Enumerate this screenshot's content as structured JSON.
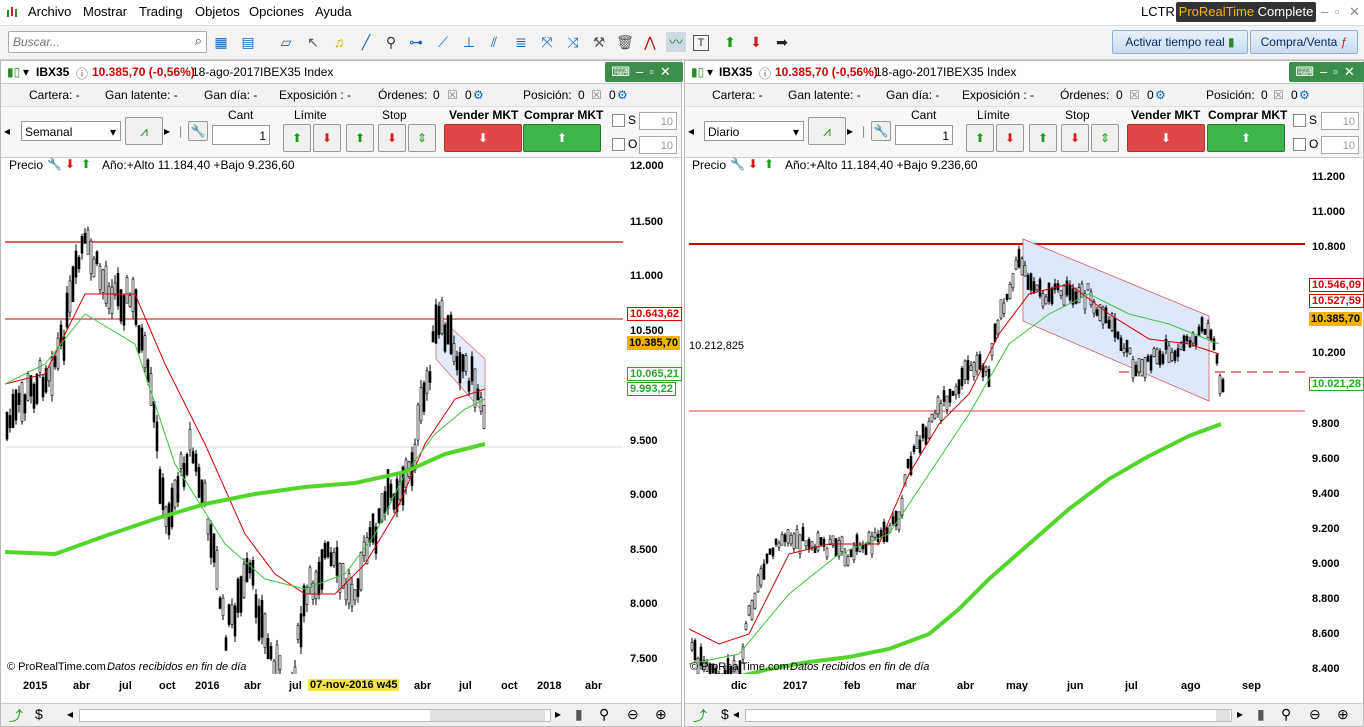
{
  "menu": [
    "Archivo",
    "Mostrar",
    "Trading",
    "Objetos",
    "Opciones",
    "Ayuda"
  ],
  "header": {
    "account": "LCTR",
    "brand_pre": "ProRealTime",
    "brand_post": "Complete"
  },
  "toolbar": {
    "search_placeholder": "Buscar...",
    "activate_label": "Activar tiempo real",
    "trade_label": "Compra/Venta"
  },
  "left": {
    "symbol": "IBX35",
    "price": "10.385,70 (-0,56%)",
    "date": "18-ago-2017",
    "index": "IBEX35 Index",
    "cartera": "Cartera: -",
    "gan_latente": "Gan latente: -",
    "gan_dia": "Gan día: -",
    "exposicion": "Exposición : -",
    "ordenes_label": "Órdenes:",
    "ordenes_val": "0",
    "ordenes_val2": "0",
    "posicion_label": "Posición:",
    "posicion_val": "0",
    "posicion_val2": "0",
    "period": "Semanal",
    "cant_label": "Cant",
    "cant": "1",
    "limite": "Límite",
    "stop": "Stop",
    "sell": "Vender MKT",
    "buy": "Comprar MKT",
    "s_label": "S",
    "o_label": "O",
    "s_val": "10",
    "o_val": "10",
    "legend_price": "Precio",
    "legend_info": "Año:+Alto 11.184,40 +Bajo 9.236,60",
    "footer_copy": "© ProRealTime.com",
    "footer_note": "Datos recibidos en fin de día",
    "yticks": [
      "12.000",
      "11.500",
      "11.000",
      "10.500",
      "9.500",
      "9.000",
      "8.500",
      "8.000",
      "7.500"
    ],
    "xticks": [
      "2015",
      "abr",
      "jul",
      "oct",
      "2016",
      "abr",
      "jul",
      "abr",
      "jul",
      "oct",
      "2018",
      "abr"
    ],
    "cursor_label": "07-nov-2016 w45",
    "price_tags": [
      {
        "text": "10.643,62",
        "color": "#d00000"
      },
      {
        "text": "10.385,70",
        "color": "#000"
      },
      {
        "text": "10.065,21",
        "color": "#29a329"
      },
      {
        "text": "9.993,22",
        "color": "#29a329"
      }
    ]
  },
  "right": {
    "symbol": "IBX35",
    "price": "10.385,70 (-0,56%)",
    "date": "18-ago-2017",
    "index": "IBEX35 Index",
    "cartera": "Cartera: -",
    "gan_latente": "Gan latente: -",
    "gan_dia": "Gan día: -",
    "exposicion": "Exposición : -",
    "ordenes_label": "Órdenes:",
    "ordenes_val": "0",
    "ordenes_val2": "0",
    "posicion_label": "Posición:",
    "posicion_val": "0",
    "posicion_val2": "0",
    "period": "Diario",
    "cant_label": "Cant",
    "cant": "1",
    "limite": "Límite",
    "stop": "Stop",
    "sell": "Vender MKT",
    "buy": "Comprar MKT",
    "s_label": "S",
    "o_label": "O",
    "s_val": "10",
    "o_val": "10",
    "legend_price": "Precio",
    "legend_info": "Año:+Alto 11.184,40 +Bajo 9.236,60",
    "footer_copy": "© ProRealTime.com",
    "footer_note": "Datos recibidos en fin de día",
    "yticks": [
      "11.200",
      "11.000",
      "10.800",
      "10.200",
      "9.800",
      "9.600",
      "9.400",
      "9.200",
      "9.000",
      "8.800",
      "8.600",
      "8.400"
    ],
    "xticks": [
      "dic",
      "2017",
      "feb",
      "mar",
      "abr",
      "may",
      "jun",
      "jul",
      "ago",
      "sep"
    ],
    "hline_label": "10.212,825",
    "price_tags": [
      {
        "text": "10.546,09",
        "color": "#d00000"
      },
      {
        "text": "10.527,59",
        "color": "#d00000"
      },
      {
        "text": "10.385,70",
        "color": "#000"
      },
      {
        "text": "10.021,28",
        "color": "#29a329"
      }
    ]
  },
  "colors": {
    "red": "#d00000",
    "green": "#22c722",
    "ma_green": "#52d62a",
    "gold": "#f0b400",
    "channel": "#dfe8fb"
  }
}
